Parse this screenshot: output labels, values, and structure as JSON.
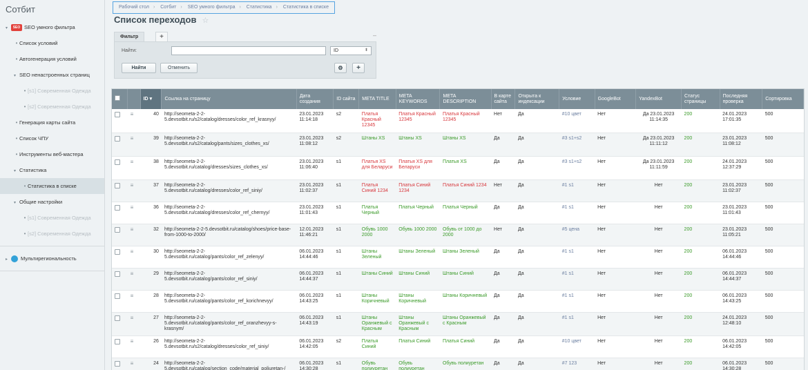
{
  "sidebar": {
    "title": "Сотбит",
    "items": [
      {
        "label": "SEO умного фильтра",
        "level": 0,
        "icon": "seo-icon",
        "expanded": true
      },
      {
        "label": "Список условий",
        "level": 1
      },
      {
        "label": "Автогенерация условий",
        "level": 1
      },
      {
        "label": "SEO ненастроенных страниц",
        "level": 1,
        "expanded": true
      },
      {
        "label": "[s1] Современная Одежда",
        "level": 2,
        "blurred": true
      },
      {
        "label": "[s2] Современная Одежда",
        "level": 2,
        "blurred": true
      },
      {
        "label": "Генерация карты сайта",
        "level": 1
      },
      {
        "label": "Список ЧПУ",
        "level": 1
      },
      {
        "label": "Инструменты веб-мастера",
        "level": 1
      },
      {
        "label": "Статистика",
        "level": 1,
        "expanded": true
      },
      {
        "label": "Статистика в списке",
        "level": 2,
        "active": true
      },
      {
        "label": "Общие настройки",
        "level": 1,
        "expanded": true
      },
      {
        "label": "[s1] Современная Одежда",
        "level": 2,
        "blurred": true
      },
      {
        "label": "[s2] Современная Одежда",
        "level": 2,
        "blurred": true
      },
      {
        "label": "Мультирегиональность",
        "level": 0,
        "icon": "multiregion-icon"
      }
    ]
  },
  "breadcrumb": [
    "Рабочий стол",
    "Сотбит",
    "SEO умного фильтра",
    "Статистика",
    "Статистика в списке"
  ],
  "page_title": "Список переходов",
  "filter": {
    "tab": "Фильтр",
    "add_tab": "+",
    "minimize": "–",
    "find_label": "Найти:",
    "find_value": "",
    "select_value": "ID",
    "find_button": "Найти",
    "cancel_button": "Отменить",
    "gear": "⚙",
    "plus": "+"
  },
  "table": {
    "headers": {
      "id": "ID",
      "link": "Ссылка на страницу",
      "created": "Дата создания",
      "site": "ID сайта",
      "meta_title": "META TITLE",
      "meta_keywords": "META KEYWORDS",
      "meta_description": "META DESCRIPTION",
      "sitemap": "В карте сайта",
      "index": "Открыта к индексации",
      "cond": "Условие",
      "google": "GoogleBot",
      "yandex": "YandexBot",
      "status": "Статус страницы",
      "last_check": "Последняя проверка",
      "sort": "Сортировка"
    },
    "rows": [
      {
        "id": "40",
        "link": "http://seometa-2-2-5.devsotbit.ru/s2/catalog/dresses/color_ref_krasnyy/",
        "created": "23.01.2023 11:14:18",
        "site": "s2",
        "title": "Платья Красный 12345",
        "keywords": "Платья Красный 12345",
        "description": "Платья Красный 12345",
        "meta_color": "red",
        "sitemap": "Нет",
        "index": "Да",
        "cond": "#10 цвет",
        "google": "Нет",
        "yandex": "Да 23.01.2023 11:14:35",
        "status": "200",
        "last_check": "24.01.2023 17:01:35",
        "sort": "500",
        "cls": "r1"
      },
      {
        "id": "39",
        "link": "http://seometa-2-2-5.devsotbit.ru/s2/catalog/pants/sizes_clothes_xs/",
        "created": "23.01.2023 11:08:12",
        "site": "s2",
        "title": "Штаны XS",
        "keywords": "Штаны XS",
        "description": "Штаны XS",
        "meta_color": "green",
        "sitemap": "Да",
        "index": "Да",
        "cond": "#3 s1+s2",
        "google": "Нет",
        "yandex": "Да 23.01.2023 11:11:12",
        "status": "200",
        "last_check": "23.01.2023 11:08:12",
        "sort": "500",
        "cls": "r1 alt"
      },
      {
        "id": "38",
        "link": "http://seometa-2-2-5.devsotbit.ru/catalog/dresses/sizes_clothes_xs/",
        "created": "23.01.2023 11:06:40",
        "site": "s1",
        "title": "Платья XS для Беларуси",
        "keywords": "Платья XS для Беларуси",
        "description": "Платья XS",
        "meta_color": "mixed38",
        "sitemap": "Да",
        "index": "Да",
        "cond": "#3 s1+s2",
        "google": "Нет",
        "yandex": "Да 23.01.2023 11:11:59",
        "status": "200",
        "last_check": "24.01.2023 12:37:29",
        "sort": "500",
        "cls": "r1"
      },
      {
        "id": "37",
        "link": "http://seometa-2-2-5.devsotbit.ru/catalog/dresses/color_ref_siniy/",
        "created": "23.01.2023 11:02:37",
        "site": "s1",
        "title": "Платья Синий 1234",
        "keywords": "Платья Синий 1234",
        "description": "Платья Синий 1234",
        "meta_color": "red",
        "sitemap": "Нет",
        "index": "Да",
        "cond": "#1 s1",
        "google": "Нет",
        "yandex": "Нет",
        "status": "200",
        "last_check": "23.01.2023 11:02:37",
        "sort": "500",
        "cls": "r2 alt"
      },
      {
        "id": "36",
        "link": "http://seometa-2-2-5.devsotbit.ru/catalog/dresses/color_ref_chernyy/",
        "created": "23.01.2023 11:01:43",
        "site": "s1",
        "title": "Платья Черный",
        "keywords": "Платья Черный",
        "description": "Платья Черный",
        "meta_color": "green",
        "sitemap": "Да",
        "index": "Да",
        "cond": "#1 s1",
        "google": "Нет",
        "yandex": "Нет",
        "status": "200",
        "last_check": "23.01.2023 11:01:43",
        "sort": "500",
        "cls": "r2"
      },
      {
        "id": "32",
        "link": "http://seometa-2-2-5.devsotbit.ru/catalog/shoes/price-base-from-1000-to-2000/",
        "created": "12.01.2023 11:46:21",
        "site": "s1",
        "title": "Обувь 1000 2000",
        "keywords": "Обувь 1000 2000",
        "description": "Обувь от 1000 до 2000",
        "meta_color": "green",
        "sitemap": "Нет",
        "index": "Да",
        "cond": "#5 цена",
        "google": "Нет",
        "yandex": "Нет",
        "status": "200",
        "last_check": "23.01.2023 11:05:21",
        "sort": "500",
        "cls": "r2 alt"
      },
      {
        "id": "30",
        "link": "http://seometa-2-2-5.devsotbit.ru/catalog/pants/color_ref_zelenyy/",
        "created": "06.01.2023 14:44:46",
        "site": "s1",
        "title": "Штаны Зеленый",
        "keywords": "Штаны Зеленый",
        "description": "Штаны Зеленый",
        "meta_color": "green",
        "sitemap": "Да",
        "index": "Да",
        "cond": "#1 s1",
        "google": "Нет",
        "yandex": "Нет",
        "status": "200",
        "last_check": "06.01.2023 14:44:46",
        "sort": "500",
        "cls": "r2"
      },
      {
        "id": "29",
        "link": "http://seometa-2-2-5.devsotbit.ru/catalog/pants/color_ref_siniy/",
        "created": "06.01.2023 14:44:37",
        "site": "s1",
        "title": "Штаны Синий",
        "keywords": "Штаны Синий",
        "description": "Штаны Синий",
        "meta_color": "green",
        "sitemap": "Да",
        "index": "Да",
        "cond": "#1 s1",
        "google": "Нет",
        "yandex": "Нет",
        "status": "200",
        "last_check": "06.01.2023 14:44:37",
        "sort": "500",
        "cls": "r2 alt"
      },
      {
        "id": "28",
        "link": "http://seometa-2-2-5.devsotbit.ru/catalog/pants/color_ref_korichnevyy/",
        "created": "06.01.2023 14:43:25",
        "site": "s1",
        "title": "Штаны Коричневый",
        "keywords": "Штаны Коричневый",
        "description": "Штаны Коричневый",
        "meta_color": "green",
        "sitemap": "Да",
        "index": "Да",
        "cond": "#1 s1",
        "google": "Нет",
        "yandex": "Нет",
        "status": "200",
        "last_check": "06.01.2023 14:43:25",
        "sort": "500",
        "cls": "r2"
      },
      {
        "id": "27",
        "link": "http://seometa-2-2-5.devsotbit.ru/catalog/pants/color_ref_oranzhevyy-s-krasnym/",
        "created": "06.01.2023 14:43:19",
        "site": "s1",
        "title": "Штаны Оранжевый с Красным",
        "keywords": "Штаны Оранжевый с Красным",
        "description": "Штаны Оранжевый с Красным",
        "meta_color": "green",
        "sitemap": "Да",
        "index": "Да",
        "cond": "#1 s1",
        "google": "Нет",
        "yandex": "Нет",
        "status": "200",
        "last_check": "24.01.2023 12:48:10",
        "sort": "500",
        "cls": "r3 alt"
      },
      {
        "id": "26",
        "link": "http://seometa-2-2-5.devsotbit.ru/s2/catalog/dresses/color_ref_siniy/",
        "created": "06.01.2023 14:42:05",
        "site": "s2",
        "title": "Платья Синий",
        "keywords": "Платья Синий",
        "description": "Платья Синий",
        "meta_color": "green",
        "sitemap": "Да",
        "index": "Да",
        "cond": "#10 цвет",
        "google": "Нет",
        "yandex": "Нет",
        "status": "200",
        "last_check": "06.01.2023 14:42:05",
        "sort": "500",
        "cls": "r2"
      },
      {
        "id": "24",
        "link": "http://seometa-2-2-5.devsotbit.ru/catalog/section_code/material_poliuretan-/",
        "created": "06.01.2023 14:30:28",
        "site": "s1",
        "title": "Обувь полиуретан",
        "keywords": "Обувь полиуретан",
        "description": "Обувь полиуретан",
        "meta_color": "green",
        "sitemap": "Да",
        "index": "Да",
        "cond": "#7 123",
        "google": "Нет",
        "yandex": "Нет",
        "status": "200",
        "last_check": "06.01.2023 14:30:28",
        "sort": "500",
        "cls": "r4 alt"
      }
    ]
  },
  "colors": {
    "meta_red": "#d7373c",
    "meta_green": "#3a9a28",
    "header": "#7c8e98",
    "active_item": "#d7e0e4"
  }
}
